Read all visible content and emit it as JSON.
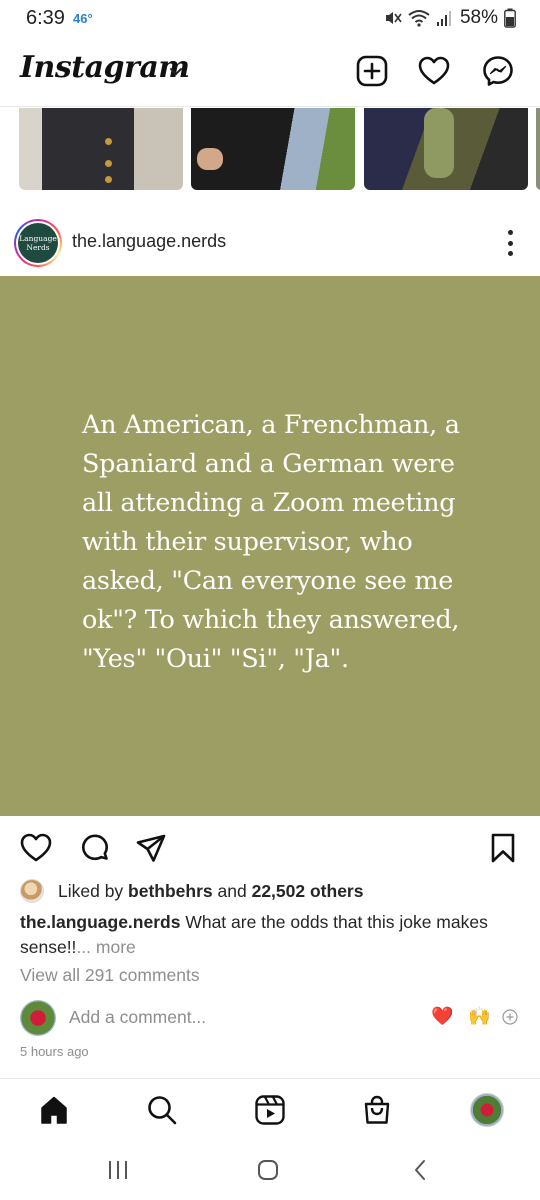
{
  "status_bar": {
    "time": "6:39",
    "temperature": "46°",
    "battery": "58%",
    "icons": [
      "mute-icon",
      "wifi-icon",
      "signal-icon",
      "battery-icon"
    ]
  },
  "header": {
    "logo": "Instagram",
    "icons": [
      "chevron-down-icon",
      "new-post-icon",
      "activity-heart-icon",
      "messenger-icon"
    ]
  },
  "post": {
    "username": "the.language.nerds",
    "avatar_text": "Language Nerds",
    "image_bg_color": "#9d9e64",
    "image_text": "An American, a Frenchman, a Spaniard and a German were all attending a Zoom meeting with their supervisor, who asked, \"Can everyone see me ok\"? To which they answered, \"Yes\" \"Oui\" \"Si\", \"Ja\".",
    "likes": {
      "prefix": "Liked by ",
      "user": "bethbehrs",
      "middle": " and ",
      "count": "22,502 others"
    },
    "caption": {
      "username": "the.language.nerds",
      "text": " What are the odds that this joke makes sense!!",
      "more": "... more"
    },
    "view_comments": "View all 291 comments",
    "add_comment_placeholder": "Add a comment...",
    "quick_reactions": [
      "❤️",
      "🙌"
    ],
    "timestamp": "5 hours ago"
  },
  "bottom_nav": {
    "items": [
      "home-icon",
      "search-icon",
      "reels-icon",
      "shop-icon",
      "profile-avatar"
    ]
  },
  "system_nav": {
    "items": [
      "recent-apps-icon",
      "home-circle-icon",
      "back-icon"
    ]
  }
}
